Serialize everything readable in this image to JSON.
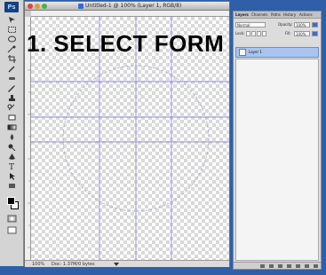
{
  "headline": "1. SELECT FORM",
  "app": {
    "logo_text": "Ps"
  },
  "document": {
    "title": "Untitled-1 @ 100% (Layer 1, RGB/8)",
    "zoom": "100%",
    "info": "Doc: 1.37M/0 bytes"
  },
  "layers_panel": {
    "tabs": [
      "Layers",
      "Channels",
      "Paths",
      "History",
      "Actions"
    ],
    "blend_mode": "Normal",
    "opacity_label": "Opacity:",
    "opacity_value": "100%",
    "lock_label": "Lock:",
    "fill_label": "Fill:",
    "fill_value": "100%",
    "layer_name": "Layer 1"
  },
  "colors": {
    "desktop": "#2e5fa8",
    "guide": "#8f8fe0",
    "selected_layer": "#a9c4ee"
  }
}
